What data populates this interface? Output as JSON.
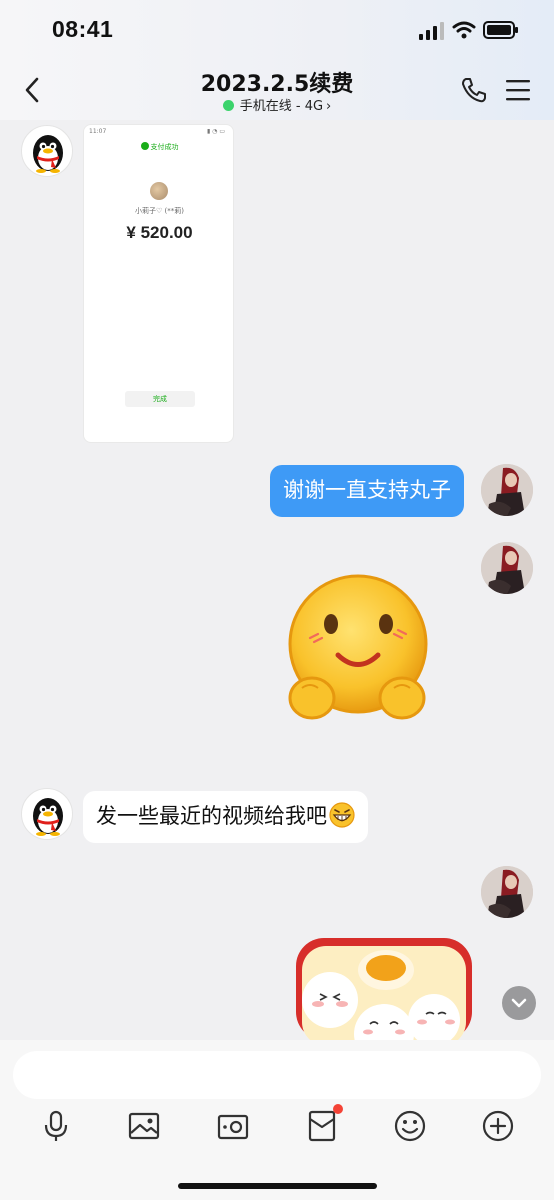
{
  "status_bar": {
    "time": "08:41",
    "icons": [
      "signal-icon",
      "wifi-icon",
      "battery-icon"
    ]
  },
  "header": {
    "title": "2023.2.5续费",
    "status_text": "手机在线 - 4G",
    "status_color": "#3bd36c",
    "icons": [
      "back-icon",
      "phone-icon",
      "menu-icon"
    ]
  },
  "messages": [
    {
      "sender": "contact",
      "type": "image",
      "payment_screenshot": {
        "time": "11:07",
        "status_icons": "▮ ◔ ▭",
        "title": "支付成功",
        "payee": "小莉子♡ (**莉)",
        "amount": "¥ 520.00",
        "done_label": "完成"
      }
    },
    {
      "sender": "me",
      "type": "text",
      "text": "谢谢一直支持丸子"
    },
    {
      "sender": "me",
      "type": "sticker",
      "sticker": "smiling-face-sticker"
    },
    {
      "sender": "contact",
      "type": "text",
      "text": "发一些最近的视频给我吧",
      "emoji": "grinning-face-icon"
    },
    {
      "sender": "me",
      "type": "sticker",
      "sticker": "rice-ball-bowl-sticker"
    }
  ],
  "input": {
    "placeholder": "",
    "value": ""
  },
  "toolbar": [
    "microphone-icon",
    "image-icon",
    "camera-icon",
    "red-packet-icon",
    "emoji-icon",
    "plus-icon"
  ],
  "colors": {
    "accent": "#3e9af6",
    "online": "#3bd36c",
    "badge": "#f44336"
  }
}
